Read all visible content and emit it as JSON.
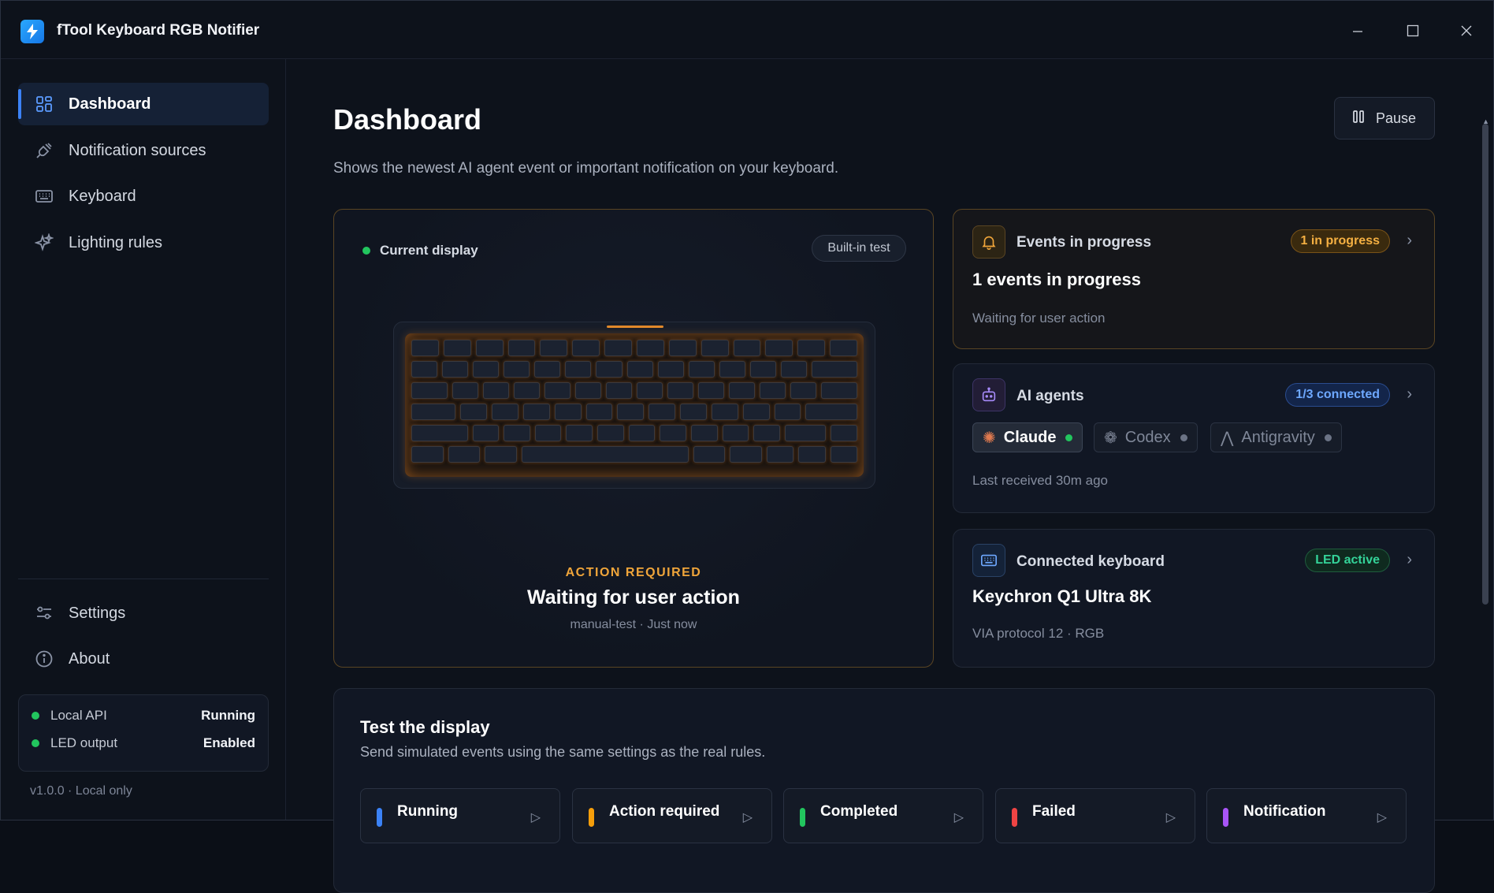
{
  "app": {
    "title": "fTool Keyboard RGB Notifier"
  },
  "window_controls": {
    "minimize": "—",
    "maximize": "☐",
    "close": "✕"
  },
  "sidebar": {
    "items": [
      {
        "label": "Dashboard",
        "icon": "dashboard-icon",
        "active": true
      },
      {
        "label": "Notification sources",
        "icon": "plug-icon",
        "active": false
      },
      {
        "label": "Keyboard",
        "icon": "keyboard-icon",
        "active": false
      },
      {
        "label": "Lighting rules",
        "icon": "sparkles-icon",
        "active": false
      }
    ],
    "bottom_items": [
      {
        "label": "Settings",
        "icon": "sliders-icon"
      },
      {
        "label": "About",
        "icon": "info-icon"
      }
    ],
    "status": [
      {
        "label": "Local API",
        "value": "Running",
        "color": "#22c55e"
      },
      {
        "label": "LED output",
        "value": "Enabled",
        "color": "#22c55e"
      }
    ],
    "version": "v1.0.0 · Local only"
  },
  "main": {
    "title": "Dashboard",
    "subtitle": "Shows the newest AI agent event or important notification on your keyboard.",
    "pause_label": "Pause",
    "current_display": {
      "label": "Current display",
      "badge": "Built-in test",
      "tag": "ACTION REQUIRED",
      "title": "Waiting for user action",
      "meta": "manual-test · Just now",
      "glow_color": "#e0892b"
    },
    "events_card": {
      "label": "Events in progress",
      "badge": "1 in progress",
      "headline": "1 events in progress",
      "detail": "Waiting for user action"
    },
    "agents_card": {
      "label": "AI agents",
      "badge": "1/3 connected",
      "agents": [
        {
          "name": "Claude",
          "connected": true
        },
        {
          "name": "Codex",
          "connected": false
        },
        {
          "name": "Antigravity",
          "connected": false
        }
      ],
      "detail": "Last received 30m ago"
    },
    "keyboard_card": {
      "label": "Connected keyboard",
      "badge": "LED active",
      "headline": "Keychron Q1 Ultra 8K",
      "detail": "VIA protocol 12 · RGB"
    },
    "test": {
      "title": "Test the display",
      "subtitle": "Send simulated events using the same settings as the real rules.",
      "buttons": [
        {
          "label": "Running",
          "color": "#3b82f6"
        },
        {
          "label": "Action required",
          "color": "#f59e0b"
        },
        {
          "label": "Completed",
          "color": "#22c55e"
        },
        {
          "label": "Failed",
          "color": "#ef4444"
        },
        {
          "label": "Notification",
          "color": "#a855f7"
        }
      ]
    }
  }
}
